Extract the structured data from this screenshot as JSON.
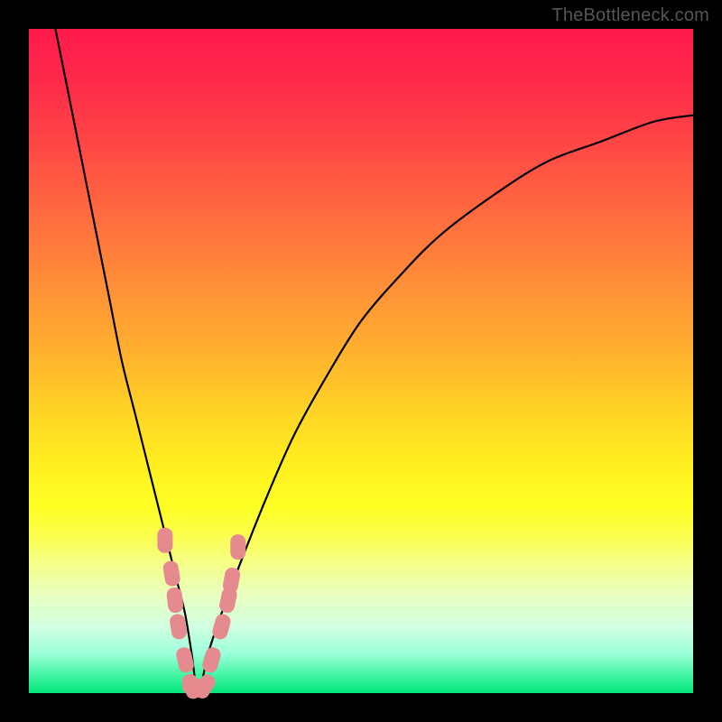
{
  "watermark": "TheBottleneck.com",
  "colors": {
    "curve_stroke": "#000000",
    "marker_fill": "#e58b8f",
    "gradient_top": "#ff1a4d",
    "gradient_bottom": "#00e57a",
    "frame": "#000000"
  },
  "chart_data": {
    "type": "line",
    "title": "",
    "xlabel": "",
    "ylabel": "",
    "xlim": [
      0,
      100
    ],
    "ylim": [
      0,
      100
    ],
    "grid": false,
    "legend": false,
    "series": [
      {
        "name": "bottleneck-curve",
        "x": [
          4,
          6,
          8,
          10,
          12,
          14,
          16,
          18,
          20,
          22,
          23.5,
          24.5,
          25.5,
          27,
          29,
          32,
          36,
          40,
          45,
          50,
          56,
          62,
          70,
          78,
          86,
          94,
          100
        ],
        "y": [
          100,
          90,
          80,
          70,
          60,
          50,
          42,
          34,
          26,
          18,
          12,
          6,
          0,
          6,
          12,
          20,
          30,
          39,
          48,
          56,
          63,
          69,
          75,
          80,
          83,
          86,
          87
        ]
      }
    ],
    "markers": {
      "name": "highlighted-points",
      "shape": "rounded-rect",
      "x": [
        20.5,
        21.5,
        22.0,
        22.5,
        23.5,
        24.5,
        25.0,
        26.5,
        27.5,
        29.0,
        30.0,
        30.5,
        31.5
      ],
      "y": [
        23,
        18,
        14,
        10,
        5,
        1,
        1,
        1,
        5,
        10,
        14,
        17,
        22
      ]
    },
    "minimum": {
      "x": 25.5,
      "y": 0
    }
  }
}
